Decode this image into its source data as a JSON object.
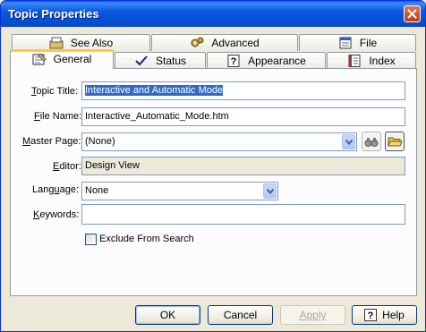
{
  "window": {
    "title": "Topic Properties"
  },
  "tabs": {
    "row_back": [
      {
        "label": "See Also",
        "icon": "see-also-icon"
      },
      {
        "label": "Advanced",
        "icon": "gear-icon"
      },
      {
        "label": "File",
        "icon": "file-icon"
      }
    ],
    "row_front": [
      {
        "label": "General",
        "icon": "general-icon",
        "active": true
      },
      {
        "label": "Status",
        "icon": "checkmark-icon"
      },
      {
        "label": "Appearance",
        "icon": "question-icon"
      },
      {
        "label": "Index",
        "icon": "index-icon"
      }
    ]
  },
  "form": {
    "topic_title": {
      "label_pre": "",
      "label_u": "T",
      "label_post": "opic Title:",
      "value": "Interactive and Automatic Mode"
    },
    "file_name": {
      "label_pre": "",
      "label_u": "F",
      "label_post": "ile Name:",
      "value": "Interactive_Automatic_Mode.htm"
    },
    "master_page": {
      "label_pre": "",
      "label_u": "M",
      "label_post": "aster Page:",
      "value": "(None)"
    },
    "editor": {
      "label_pre": "",
      "label_u": "E",
      "label_post": "ditor:",
      "value": "Design View"
    },
    "language": {
      "label_pre": "Lang",
      "label_u": "u",
      "label_post": "age:",
      "value": "None"
    },
    "keywords": {
      "label_pre": "",
      "label_u": "K",
      "label_post": "eywords:",
      "value": ""
    },
    "exclude": {
      "label": "Exclude From Search",
      "checked": false
    }
  },
  "buttons": {
    "ok": "OK",
    "cancel": "Cancel",
    "apply": "Apply",
    "help": "Help"
  }
}
